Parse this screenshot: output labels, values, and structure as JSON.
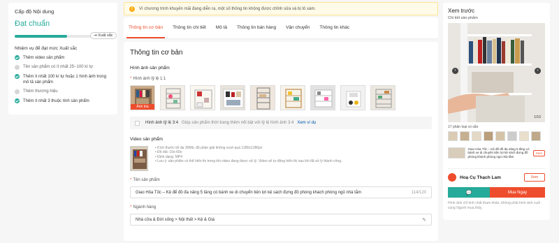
{
  "level_panel": {
    "title": "Cấp độ Nội dung",
    "level": "Đạt chuẩn",
    "progress": 0.68,
    "next_level_tag": "Xuất sắc",
    "tasks_heading": "Nhiệm vụ để đạt mức Xuất sắc",
    "tasks": [
      {
        "label": "Thêm video sản phẩm",
        "done": true
      },
      {
        "label": "Tên sản phẩm có ít nhất 25~100 kí tự",
        "done": false
      },
      {
        "label": "Thêm ít nhất 100 kí tự hoặc 1 hình ảnh trong mô tả sản phẩm",
        "done": true
      },
      {
        "label": "Thêm thương hiệu",
        "done": false
      },
      {
        "label": "Thêm ít nhất 3 thuộc tính sản phẩm",
        "done": true
      }
    ]
  },
  "alert": {
    "text": "Vì chương trình khuyến mãi đang diễn ra, một số thông tin không được chỉnh sửa và bị tô xám."
  },
  "tabs": [
    "Thông tin cơ bản",
    "Thông tin chi tiết",
    "Mô tả",
    "Thông tin bán hàng",
    "Vận chuyển",
    "Thông tin khác"
  ],
  "main": {
    "section_title": "Thông tin cơ bản",
    "images_heading": "Hình ảnh sản phẩm",
    "images_label": "Hình ảnh tỷ lệ 1:1",
    "cover_badge": "Ảnh bìa",
    "ratio_label": "Hình ảnh tỷ lệ 3:4",
    "ratio_hint": "Giúp sản phẩm thời trang thêm nổi bật với tỷ lệ hình ảnh 3:4",
    "ratio_link": "Xem ví dụ",
    "video_heading": "Video sản phẩm",
    "video_notes": [
      "Kích thước tối đa 30Mb, độ phân giải không vượt quá 1280x1280px",
      "Độ dài: 10s-60s",
      "Định dạng: MP4",
      "Lưu ý: sản phẩm có thể hiển thị trong khi video đang được xử lý. Video sẽ tự động hiển thị sau khi đã xử lý thành công."
    ],
    "name_label": "Tên sản phẩm",
    "name_value": "Giao Hỏa Tốc – Kệ để đồ đa năng 5 tầng có bánh xe di chuyển tiện lợi kệ sách đựng đồ phòng khách phòng ngủ nhà tắm",
    "name_count": "114/120",
    "category_label": "Ngành hàng",
    "category_value": "Nhà cửa & Đời sống > Nội thất > Kệ & Giá"
  },
  "preview": {
    "title": "Xem trước",
    "subtitle": "Chi tiết sản phẩm",
    "image_counter": "1/10",
    "variants_label": "17 phân loại có sẵn",
    "short_desc": "Giao Hỏa Tốc – Kệ để đồ đa năng 5 tầng có bánh xe di chuyển tiện lợi kệ sách đựng đồ phòng khách phòng ngủ nhà tắm",
    "view_btn": "Xem",
    "shop_name": "Hoạ Cụ Thạch Lam",
    "shop_btn": "Xem",
    "chat_icon": "chat-icon",
    "buy_label": "Mua Ngay",
    "disclaimer": "Hình ảnh chỉ tính chất tham khảo, không phải hình ảnh cuối cùng Người mua thấy."
  }
}
